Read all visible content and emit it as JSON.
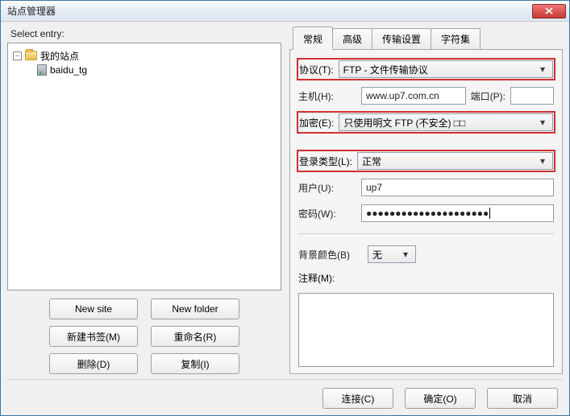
{
  "window": {
    "title": "站点管理器"
  },
  "left": {
    "select_entry": "Select entry:",
    "root": "我的站点",
    "site": "baidu_tg",
    "buttons": {
      "new_site": "New site",
      "new_folder": "New folder",
      "new_bookmark": "新建书签(M)",
      "rename": "重命名(R)",
      "delete": "删除(D)",
      "copy": "复制(I)"
    }
  },
  "tabs": {
    "general": "常规",
    "advanced": "高级",
    "transfer": "传输设置",
    "charset": "字符集"
  },
  "form": {
    "protocol_label": "协议(T):",
    "protocol_value": "FTP - 文件传输协议",
    "host_label": "主机(H):",
    "host_value": "www.up7.com.cn",
    "port_label": "端口(P):",
    "port_value": "",
    "encryption_label": "加密(E):",
    "encryption_value": "只使用明文 FTP (不安全) □□",
    "logon_label": "登录类型(L):",
    "logon_value": "正常",
    "user_label": "用户(U):",
    "user_value": "up7",
    "password_label": "密码(W):",
    "password_mask": "●●●●●●●●●●●●●●●●●●●●●",
    "bgcolor_label": "背景颜色(B)",
    "bgcolor_value": "无",
    "notes_label": "注释(M):"
  },
  "footer": {
    "connect": "连接(C)",
    "ok": "确定(O)",
    "cancel": "取消"
  }
}
